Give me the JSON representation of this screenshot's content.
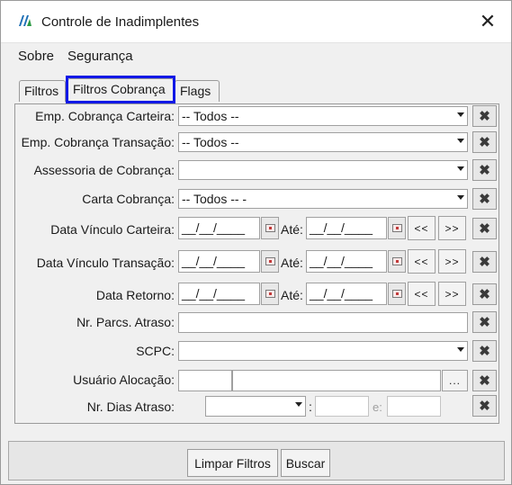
{
  "window": {
    "title": "Controle de Inadimplentes",
    "close_glyph": "✕"
  },
  "menu": {
    "items": [
      "Sobre",
      "Segurança"
    ]
  },
  "tabs": [
    "Filtros",
    "Filtros Cobrança",
    "Flags"
  ],
  "active_tab": "Filtros Cobrança",
  "form": {
    "emp_cobranca_carteira": {
      "label": "Emp. Cobrança Carteira:",
      "value": "-- Todos --"
    },
    "emp_cobranca_transacao": {
      "label": "Emp. Cobrança Transação:",
      "value": "-- Todos --"
    },
    "assessoria_cobranca": {
      "label": "Assessoria de Cobrança:",
      "value": ""
    },
    "carta_cobranca": {
      "label": "Carta Cobrança:",
      "value": "-- Todos -- -"
    },
    "data_vinculo_carteira": {
      "label": "Data Vínculo Carteira:",
      "from": "__/__/____",
      "ate": "Até:",
      "to": "__/__/____",
      "prev": "<<",
      "next": ">>"
    },
    "data_vinculo_transacao": {
      "label": "Data Vínculo Transação:",
      "from": "__/__/____",
      "ate": "Até:",
      "to": "__/__/____",
      "prev": "<<",
      "next": ">>"
    },
    "data_retorno": {
      "label": "Data Retorno:",
      "from": "__/__/____",
      "ate": "Até:",
      "to": "__/__/____",
      "prev": "<<",
      "next": ">>"
    },
    "nr_parcs_atraso": {
      "label": "Nr. Parcs. Atraso:",
      "value": ""
    },
    "scpc": {
      "label": "SCPC:",
      "value": ""
    },
    "usuario_alocacao": {
      "label": "Usuário Alocação:",
      "code": "",
      "name": "",
      "browse": "..."
    },
    "nr_dias_atraso": {
      "label": "Nr. Dias Atraso:",
      "op": "",
      "colon": ":",
      "from": "",
      "e": "e:",
      "to": ""
    }
  },
  "clear_glyph": "✖",
  "buttons": {
    "limpar": "Limpar Filtros",
    "buscar": "Buscar"
  }
}
